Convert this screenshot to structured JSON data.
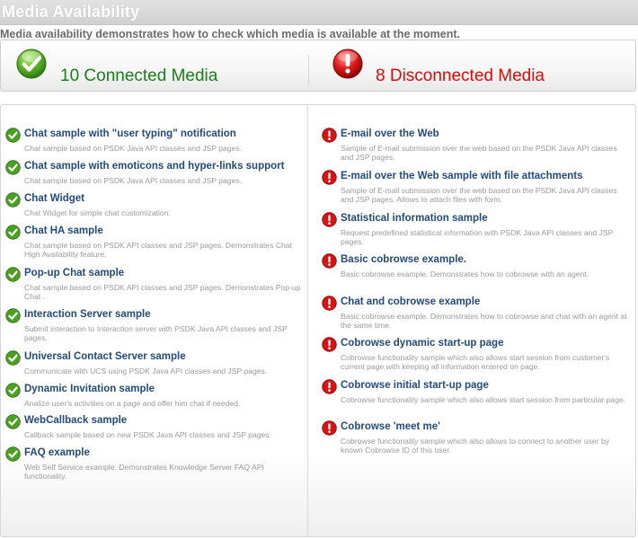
{
  "page": {
    "title": "Media Availability",
    "description": "Media availability demonstrates how to check which media is available at the moment."
  },
  "summary": {
    "connected_label": "10 Connected Media",
    "disconnected_label": "8 Disconnected Media",
    "connected_icon": "green-checkmark-icon",
    "disconnected_icon": "red-exclamation-icon"
  },
  "colors": {
    "connected": "#1a7f1a",
    "disconnected": "#e00a0a",
    "item_title": "#234a7a",
    "item_desc": "#9a9a9a"
  },
  "connected_media": [
    {
      "title": "Chat sample with \"user typing\" notification",
      "desc": "Chat sample based on PSDK Java API classes and JSP pages."
    },
    {
      "title": "Chat sample with emoticons and hyper-links support",
      "desc": "Chat sample based on PSDK Java API classes and JSP pages."
    },
    {
      "title": "Chat Widget",
      "desc": "Chat Widget for simple chat customization."
    },
    {
      "title": "Chat HA sample",
      "desc": "Chat sample based on PSDK API classes and JSP pages. Demonstrates Chat High Availability feature."
    },
    {
      "title": "Pop-up Chat sample",
      "desc": "Chat sample based on PSDK API classes and JSP pages. Demonstrates Pop-up Chat ."
    },
    {
      "title": "Interaction Server sample",
      "desc": "Submit interaction to Interaction server with PSDK Java API classes and JSP pages."
    },
    {
      "title": "Universal Contact Server sample",
      "desc": "Communicate with UCS using PSDK Java API classes and JSP pages."
    },
    {
      "title": "Dynamic Invitation sample",
      "desc": "Analize user's activities on a page and offer him chat if needed."
    },
    {
      "title": "WebCallback sample",
      "desc": "Callback sample based on new PSDK Java API classes and JSP pages."
    },
    {
      "title": "FAQ example",
      "desc": "Web Self Service example. Demonstrates Knowledge Server FAQ API functionality."
    }
  ],
  "disconnected_media": [
    {
      "title": "E-mail over the Web",
      "desc": "Sample of E-mail submission over the web based on the PSDK Java API classes and JSP pages."
    },
    {
      "title": "E-mail over the Web sample with file attachments",
      "desc": "Sample of E-mail submission over the web based on the PSDK Java API classes and JSP pages. Allows to attach files with form."
    },
    {
      "title": "Statistical information sample",
      "desc": "Request predefined statistical information with PSDK Java API classes and JSP pages."
    },
    {
      "title": "Basic cobrowse example.",
      "desc": "Basic cobrowse example. Demonstrates how to cobrowse with an agent."
    },
    {
      "title": "Chat and cobrowse example",
      "desc": "Basic cobrowse example. Demonstrates how to cobrowse and chat with an agent at the same time."
    },
    {
      "title": "Cobrowse dynamic start-up page",
      "desc": "Cobrowse functionality sample which also allows start session from customer's current page with keeping all information entered on page."
    },
    {
      "title": "Cobrowse initial start-up page",
      "desc": "Cobrowse functionality sample which also allows start session from particular page."
    },
    {
      "title": "Cobrowse 'meet me'",
      "desc": "Cobrowse functionality sample which also allows to connect to another user by known Cobrowse ID of this user."
    }
  ]
}
